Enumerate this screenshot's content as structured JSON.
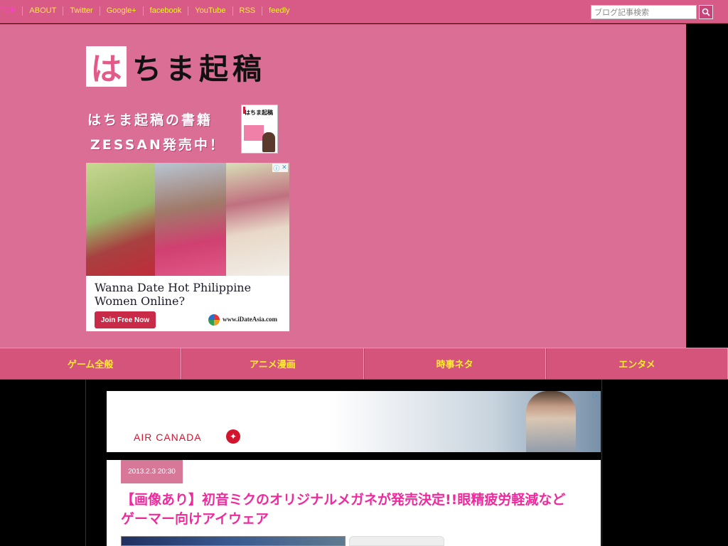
{
  "topnav": {
    "items": [
      "TOP",
      "ABOUT",
      "Twitter",
      "Google+",
      "facebook",
      "YouTube",
      "RSS",
      "feedly"
    ]
  },
  "search": {
    "placeholder": "ブログ記事検索",
    "button_icon": "search-icon"
  },
  "site": {
    "logo_mark": "は",
    "logo_rest": "ちま起稿"
  },
  "book_promo": {
    "line1": "はちま起稿の書籍",
    "line2": "ZESSAN発売中！",
    "cover_title": "はちま起稿"
  },
  "ad1": {
    "headline": "Wanna Date Hot Philippine Women Online?",
    "button": "Join Free Now",
    "url": "www.iDateAsia.com"
  },
  "categories": [
    "ゲーム全般",
    "アニメ漫画",
    "時事ネタ",
    "エンタメ"
  ],
  "ad2": {
    "brand": "AIR CANADA"
  },
  "article": {
    "date": "2013.2.3 20:30",
    "title": "【画像あり】初音ミクのオリジナルメガネが発売決定!!眼精疲労軽減などゲーマー向けアイウェア"
  },
  "colors": {
    "header_bg": "#db6e94",
    "topbar_bg": "#d85a86",
    "nav_text": "#ffec30",
    "title_pink": "#ee2a9c",
    "logo_pink": "#e25a88"
  }
}
